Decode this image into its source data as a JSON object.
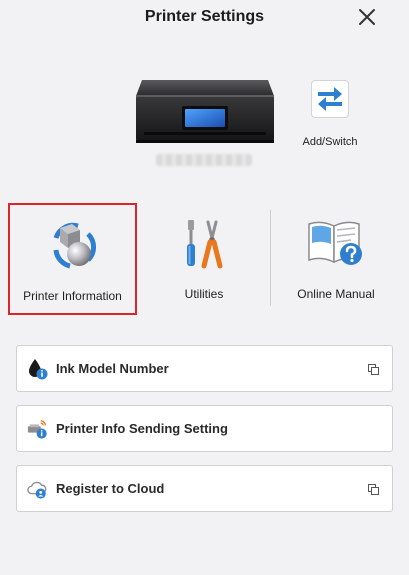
{
  "header": {
    "title": "Printer Settings"
  },
  "printer": {
    "switch_label": "Add/Switch"
  },
  "tiles": [
    {
      "label": "Printer Information",
      "selected": true
    },
    {
      "label": "Utilities",
      "selected": false
    },
    {
      "label": "Online Manual",
      "selected": false
    }
  ],
  "list": [
    {
      "label": "Ink Model Number",
      "external": true
    },
    {
      "label": "Printer Info Sending Setting",
      "external": false
    },
    {
      "label": "Register to Cloud",
      "external": true
    }
  ],
  "colors": {
    "background": "#f2f2f4",
    "accent_blue": "#2f7fd0",
    "selection_red": "#d9262b"
  }
}
